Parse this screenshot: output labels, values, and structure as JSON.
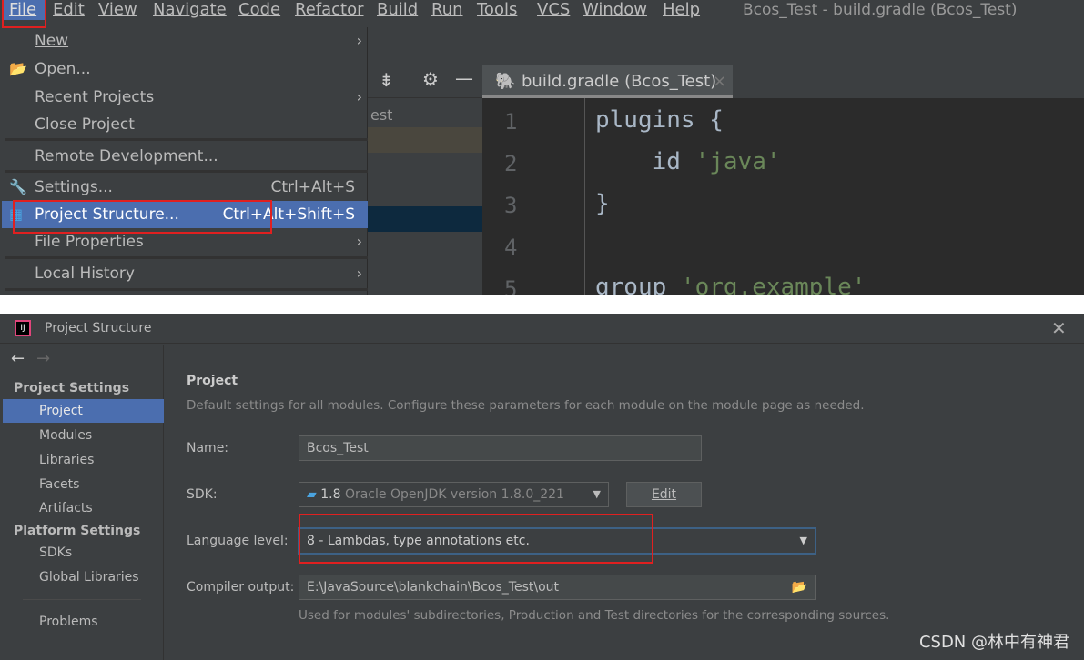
{
  "menubar": {
    "items": [
      "File",
      "Edit",
      "View",
      "Navigate",
      "Code",
      "Refactor",
      "Build",
      "Run",
      "Tools",
      "VCS",
      "Window",
      "Help"
    ],
    "window_title": "Bcos_Test - build.gradle (Bcos_Test)"
  },
  "file_menu": {
    "items": [
      {
        "label": "New",
        "submenu": true
      },
      {
        "label": "Open...",
        "icon": "folder-open-icon"
      },
      {
        "label": "Recent Projects",
        "submenu": true
      },
      {
        "label": "Close Project"
      },
      {
        "label": "Remote Development..."
      },
      {
        "label": "Settings...",
        "shortcut": "Ctrl+Alt+S",
        "icon": "wrench-icon"
      },
      {
        "label": "Project Structure...",
        "shortcut": "Ctrl+Alt+Shift+S",
        "icon": "project-structure-icon",
        "selected": true
      },
      {
        "label": "File Properties",
        "submenu": true
      },
      {
        "label": "Local History",
        "submenu": true
      }
    ]
  },
  "project_pane": {
    "partial_text": "est"
  },
  "editor": {
    "tab": "build.gradle (Bcos_Test)",
    "lines": [
      {
        "n": "1",
        "code": "plugins {",
        "str": ""
      },
      {
        "n": "2",
        "code": "    id ",
        "str": "'java'"
      },
      {
        "n": "3",
        "code": "}",
        "str": ""
      },
      {
        "n": "4",
        "code": "",
        "str": ""
      },
      {
        "n": "5",
        "code": "group ",
        "str": "'org.example'"
      }
    ]
  },
  "dialog": {
    "title": "Project Structure",
    "sidebar": {
      "project_settings": "Project Settings",
      "project_items": [
        "Project",
        "Modules",
        "Libraries",
        "Facets",
        "Artifacts"
      ],
      "platform_settings": "Platform Settings",
      "platform_items": [
        "SDKs",
        "Global Libraries"
      ],
      "problems": "Problems",
      "selected": "Project"
    },
    "heading": "Project",
    "description": "Default settings for all modules. Configure these parameters for each module on the module page as needed.",
    "name_label": "Name:",
    "name_value": "Bcos_Test",
    "sdk_label": "SDK:",
    "sdk_version": "1.8",
    "sdk_detail": "Oracle OpenJDK version 1.8.0_221",
    "edit_button": "Edit",
    "language_label": "Language level:",
    "language_value": "8 - Lambdas, type annotations etc.",
    "compiler_label": "Compiler output:",
    "compiler_value": "E:\\JavaSource\\blankchain\\Bcos_Test\\out",
    "compiler_hint": "Used for modules' subdirectories, Production and Test directories for the corresponding sources."
  },
  "watermark": "CSDN @林中有神君",
  "colors": {
    "highlight": "#4b6eaf",
    "annotation": "#e02020",
    "string": "#6a8759"
  }
}
